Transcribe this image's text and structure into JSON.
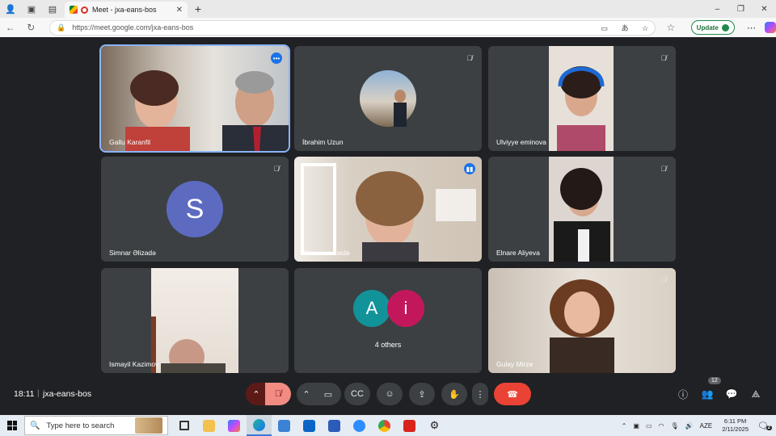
{
  "browser": {
    "tab_title": "Meet - jxa-eans-bos",
    "url": "https://meet.google.com/jxa-eans-bos",
    "update_label": "Update",
    "new_tab_glyph": "+",
    "window_controls": [
      "–",
      "❐",
      "✕"
    ]
  },
  "meeting": {
    "time": "18:11",
    "code": "jxa-eans-bos",
    "participant_count": "12",
    "others_label": "4 others"
  },
  "participants": [
    {
      "name": "Gallu Karanfil",
      "muted": false,
      "speaking": false,
      "has_more": true
    },
    {
      "name": "İbrahim Uzun",
      "muted": true
    },
    {
      "name": "Ulviyye eminova",
      "muted": true
    },
    {
      "name": "Simnar Əlizadə",
      "muted": true,
      "initial": "S",
      "avatar_color": "#5c6bc0"
    },
    {
      "name": "Omarova Faida",
      "muted": false,
      "speaking": true
    },
    {
      "name": "Elnare Aliyeva",
      "muted": true
    },
    {
      "name": "Ismayil Kazimov",
      "muted": false
    },
    {
      "name": "Gulay Mirze",
      "muted": true
    }
  ],
  "others_avatars": [
    {
      "initial": "A",
      "color": "#12939a"
    },
    {
      "initial": "i",
      "color": "#c2185b"
    }
  ],
  "taskbar": {
    "search_placeholder": "Type here to search",
    "language": "AZE",
    "time": "6:11 PM",
    "date": "2/11/2025",
    "notification_count": "2"
  }
}
